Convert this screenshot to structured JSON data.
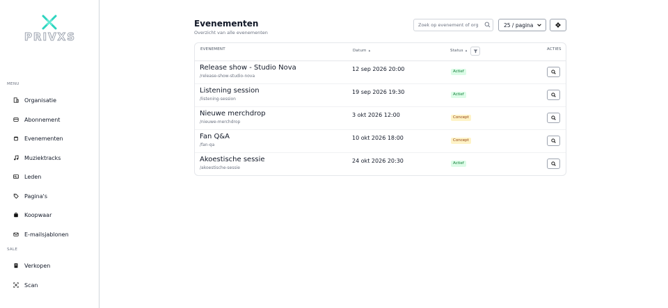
{
  "app": {
    "logo_text": "PRIVXS"
  },
  "sidebar": {
    "menu_label": "MENU",
    "menu_items": [
      {
        "label": "Organisatie",
        "icon": "building-icon"
      },
      {
        "label": "Abonnement",
        "icon": "card-icon"
      },
      {
        "label": "Evenementen",
        "icon": "calendar-icon"
      },
      {
        "label": "Muziektracks",
        "icon": "music-icon"
      },
      {
        "label": "Leden",
        "icon": "id-card-icon"
      },
      {
        "label": "Pagina's",
        "icon": "tag-icon"
      },
      {
        "label": "Koopwaar",
        "icon": "bag-icon"
      },
      {
        "label": "E-mailsjablonen",
        "icon": "mail-icon"
      }
    ],
    "sale_label": "SALE",
    "sale_items": [
      {
        "label": "Verkopen",
        "icon": "receipt-icon"
      },
      {
        "label": "Scan",
        "icon": "scan-icon"
      }
    ]
  },
  "header": {
    "title": "Evenementen",
    "subtitle": "Overzicht van alle evenementen",
    "search_placeholder": "Zoek op evenement of org",
    "page_size": "25 / pagina"
  },
  "table": {
    "columns": {
      "event": "EVENEMENT",
      "date": "Datum",
      "status": "Status",
      "actions": "ACTIES"
    },
    "rows": [
      {
        "name": "Release show - Studio Nova",
        "slug": "/release-show-studio-nova",
        "date": "12 sep 2026 20:00",
        "status": "Actief"
      },
      {
        "name": "Listening session",
        "slug": "/listening-session",
        "date": "19 sep 2026 19:30",
        "status": "Actief"
      },
      {
        "name": "Nieuwe merchdrop",
        "slug": "/nieuwe-merchdrop",
        "date": "3 okt 2026 12:00",
        "status": "Concept"
      },
      {
        "name": "Fan Q&A",
        "slug": "/fan-qa",
        "date": "10 okt 2026 18:00",
        "status": "Concept"
      },
      {
        "name": "Akoestische sessie",
        "slug": "/akoestische-sessie",
        "date": "24 okt 2026 20:30",
        "status": "Actief"
      }
    ]
  },
  "colors": {
    "brand": "#2dd4bf",
    "active_bg": "#dcfce7",
    "concept_bg": "#fef3c7"
  }
}
